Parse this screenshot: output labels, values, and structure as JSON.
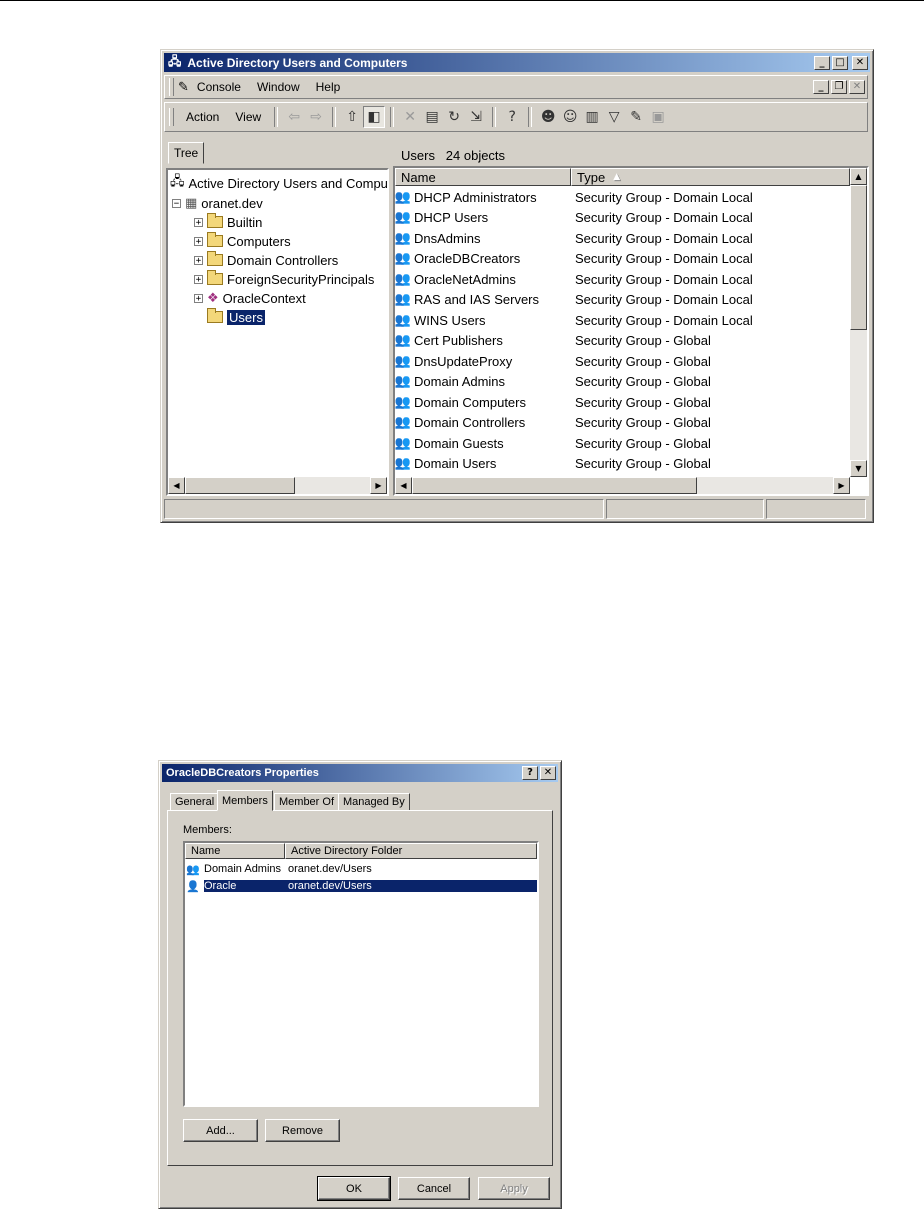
{
  "ad_window": {
    "title": "Active Directory Users and Computers",
    "menu": [
      "Console",
      "Window",
      "Help"
    ],
    "action_menu": [
      "Action",
      "View"
    ],
    "tree_tab": "Tree",
    "status_text": "Users   24 objects",
    "tree": {
      "root": "Active Directory Users and Compu",
      "domain": "oranet.dev",
      "children": [
        "Builtin",
        "Computers",
        "Domain Controllers",
        "ForeignSecurityPrincipals",
        "OracleContext",
        "Users"
      ],
      "selected": "Users"
    },
    "columns": [
      "Name",
      "Type"
    ],
    "rows": [
      {
        "name": "DHCP Administrators",
        "type": "Security Group - Domain Local"
      },
      {
        "name": "DHCP Users",
        "type": "Security Group - Domain Local"
      },
      {
        "name": "DnsAdmins",
        "type": "Security Group - Domain Local"
      },
      {
        "name": "OracleDBCreators",
        "type": "Security Group - Domain Local"
      },
      {
        "name": "OracleNetAdmins",
        "type": "Security Group - Domain Local"
      },
      {
        "name": "RAS and IAS Servers",
        "type": "Security Group - Domain Local"
      },
      {
        "name": "WINS Users",
        "type": "Security Group - Domain Local"
      },
      {
        "name": "Cert Publishers",
        "type": "Security Group - Global"
      },
      {
        "name": "DnsUpdateProxy",
        "type": "Security Group - Global"
      },
      {
        "name": "Domain Admins",
        "type": "Security Group - Global"
      },
      {
        "name": "Domain Computers",
        "type": "Security Group - Global"
      },
      {
        "name": "Domain Controllers",
        "type": "Security Group - Global"
      },
      {
        "name": "Domain Guests",
        "type": "Security Group - Global"
      },
      {
        "name": "Domain Users",
        "type": "Security Group - Global"
      }
    ]
  },
  "props_dialog": {
    "title": "OracleDBCreators Properties",
    "tabs": [
      "General",
      "Members",
      "Member Of",
      "Managed By"
    ],
    "active_tab": "Members",
    "members_label": "Members:",
    "columns": [
      "Name",
      "Active Directory Folder"
    ],
    "members": [
      {
        "name": "Domain Admins",
        "folder": "oranet.dev/Users",
        "selected": false
      },
      {
        "name": "Oracle",
        "folder": "oranet.dev/Users",
        "selected": true
      }
    ],
    "buttons": {
      "add": "Add...",
      "remove": "Remove",
      "ok": "OK",
      "cancel": "Cancel",
      "apply": "Apply"
    }
  },
  "colors": {
    "titlebar_start": "#0a246a",
    "titlebar_end": "#a6caf0",
    "selection": "#0a246a",
    "face": "#d4d0c8"
  }
}
